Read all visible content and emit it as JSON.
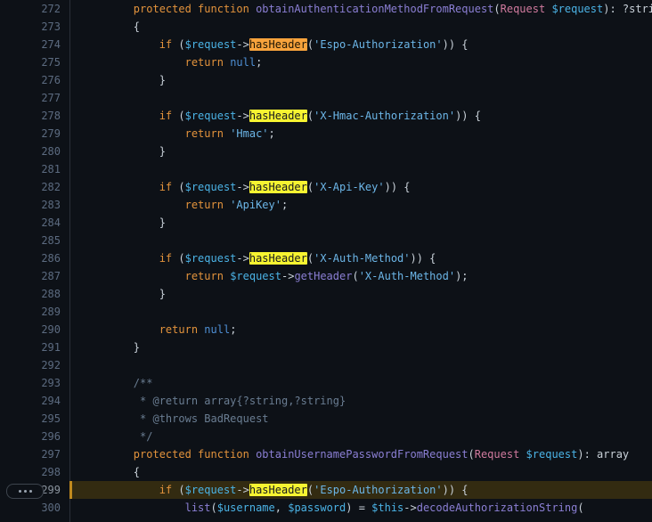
{
  "editor": {
    "background": "#0d1117",
    "line_height_px": 20,
    "font_size_px": 12,
    "gutter_rule_color": "#2a3038",
    "active_line_background": "#332b11",
    "active_line_marker_color": "#c08a1e",
    "search_current_match_color": "#f8a33c",
    "search_match_color": "#f7f431",
    "search_term": "hasHeader",
    "gutter": {
      "more_actions_label": "•••",
      "more_actions_line": "299"
    }
  },
  "lines": [
    {
      "no": "272",
      "active": false,
      "tokens": [
        {
          "text": "        ",
          "cls": "t-plain"
        },
        {
          "text": "protected function ",
          "cls": "t-kw"
        },
        {
          "text": "obtainAuthenticationMethodFromRequest",
          "cls": "t-fn"
        },
        {
          "text": "(",
          "cls": "t-punc"
        },
        {
          "text": "Request",
          "cls": "t-type"
        },
        {
          "text": " ",
          "cls": "t-plain"
        },
        {
          "text": "$request",
          "cls": "t-var"
        },
        {
          "text": "): ?string",
          "cls": "t-plain"
        }
      ]
    },
    {
      "no": "273",
      "active": false,
      "tokens": [
        {
          "text": "        {",
          "cls": "t-punc"
        }
      ]
    },
    {
      "no": "274",
      "active": false,
      "tokens": [
        {
          "text": "            ",
          "cls": "t-plain"
        },
        {
          "text": "if",
          "cls": "t-kw"
        },
        {
          "text": " (",
          "cls": "t-punc"
        },
        {
          "text": "$request",
          "cls": "t-var"
        },
        {
          "text": "->",
          "cls": "t-punc"
        },
        {
          "text": "hasHeader",
          "cls": "hl-current"
        },
        {
          "text": "(",
          "cls": "t-punc"
        },
        {
          "text": "'Espo-Authorization'",
          "cls": "t-str"
        },
        {
          "text": ")) {",
          "cls": "t-punc"
        }
      ]
    },
    {
      "no": "275",
      "active": false,
      "tokens": [
        {
          "text": "                ",
          "cls": "t-plain"
        },
        {
          "text": "return",
          "cls": "t-kw"
        },
        {
          "text": " ",
          "cls": "t-plain"
        },
        {
          "text": "null",
          "cls": "t-const"
        },
        {
          "text": ";",
          "cls": "t-punc"
        }
      ]
    },
    {
      "no": "276",
      "active": false,
      "tokens": [
        {
          "text": "            }",
          "cls": "t-punc"
        }
      ]
    },
    {
      "no": "277",
      "active": false,
      "tokens": []
    },
    {
      "no": "278",
      "active": false,
      "tokens": [
        {
          "text": "            ",
          "cls": "t-plain"
        },
        {
          "text": "if",
          "cls": "t-kw"
        },
        {
          "text": " (",
          "cls": "t-punc"
        },
        {
          "text": "$request",
          "cls": "t-var"
        },
        {
          "text": "->",
          "cls": "t-punc"
        },
        {
          "text": "hasHeader",
          "cls": "hl-match"
        },
        {
          "text": "(",
          "cls": "t-punc"
        },
        {
          "text": "'X-Hmac-Authorization'",
          "cls": "t-str"
        },
        {
          "text": ")) {",
          "cls": "t-punc"
        }
      ]
    },
    {
      "no": "279",
      "active": false,
      "tokens": [
        {
          "text": "                ",
          "cls": "t-plain"
        },
        {
          "text": "return",
          "cls": "t-kw"
        },
        {
          "text": " ",
          "cls": "t-plain"
        },
        {
          "text": "'Hmac'",
          "cls": "t-str"
        },
        {
          "text": ";",
          "cls": "t-punc"
        }
      ]
    },
    {
      "no": "280",
      "active": false,
      "tokens": [
        {
          "text": "            }",
          "cls": "t-punc"
        }
      ]
    },
    {
      "no": "281",
      "active": false,
      "tokens": []
    },
    {
      "no": "282",
      "active": false,
      "tokens": [
        {
          "text": "            ",
          "cls": "t-plain"
        },
        {
          "text": "if",
          "cls": "t-kw"
        },
        {
          "text": " (",
          "cls": "t-punc"
        },
        {
          "text": "$request",
          "cls": "t-var"
        },
        {
          "text": "->",
          "cls": "t-punc"
        },
        {
          "text": "hasHeader",
          "cls": "hl-match"
        },
        {
          "text": "(",
          "cls": "t-punc"
        },
        {
          "text": "'X-Api-Key'",
          "cls": "t-str"
        },
        {
          "text": ")) {",
          "cls": "t-punc"
        }
      ]
    },
    {
      "no": "283",
      "active": false,
      "tokens": [
        {
          "text": "                ",
          "cls": "t-plain"
        },
        {
          "text": "return",
          "cls": "t-kw"
        },
        {
          "text": " ",
          "cls": "t-plain"
        },
        {
          "text": "'ApiKey'",
          "cls": "t-str"
        },
        {
          "text": ";",
          "cls": "t-punc"
        }
      ]
    },
    {
      "no": "284",
      "active": false,
      "tokens": [
        {
          "text": "            }",
          "cls": "t-punc"
        }
      ]
    },
    {
      "no": "285",
      "active": false,
      "tokens": []
    },
    {
      "no": "286",
      "active": false,
      "tokens": [
        {
          "text": "            ",
          "cls": "t-plain"
        },
        {
          "text": "if",
          "cls": "t-kw"
        },
        {
          "text": " (",
          "cls": "t-punc"
        },
        {
          "text": "$request",
          "cls": "t-var"
        },
        {
          "text": "->",
          "cls": "t-punc"
        },
        {
          "text": "hasHeader",
          "cls": "hl-match"
        },
        {
          "text": "(",
          "cls": "t-punc"
        },
        {
          "text": "'X-Auth-Method'",
          "cls": "t-str"
        },
        {
          "text": ")) {",
          "cls": "t-punc"
        }
      ]
    },
    {
      "no": "287",
      "active": false,
      "tokens": [
        {
          "text": "                ",
          "cls": "t-plain"
        },
        {
          "text": "return",
          "cls": "t-kw"
        },
        {
          "text": " ",
          "cls": "t-plain"
        },
        {
          "text": "$request",
          "cls": "t-var"
        },
        {
          "text": "->",
          "cls": "t-punc"
        },
        {
          "text": "getHeader",
          "cls": "t-fn"
        },
        {
          "text": "(",
          "cls": "t-punc"
        },
        {
          "text": "'X-Auth-Method'",
          "cls": "t-str"
        },
        {
          "text": ");",
          "cls": "t-punc"
        }
      ]
    },
    {
      "no": "288",
      "active": false,
      "tokens": [
        {
          "text": "            }",
          "cls": "t-punc"
        }
      ]
    },
    {
      "no": "289",
      "active": false,
      "tokens": []
    },
    {
      "no": "290",
      "active": false,
      "tokens": [
        {
          "text": "            ",
          "cls": "t-plain"
        },
        {
          "text": "return",
          "cls": "t-kw"
        },
        {
          "text": " ",
          "cls": "t-plain"
        },
        {
          "text": "null",
          "cls": "t-const"
        },
        {
          "text": ";",
          "cls": "t-punc"
        }
      ]
    },
    {
      "no": "291",
      "active": false,
      "tokens": [
        {
          "text": "        }",
          "cls": "t-punc"
        }
      ]
    },
    {
      "no": "292",
      "active": false,
      "tokens": []
    },
    {
      "no": "293",
      "active": false,
      "tokens": [
        {
          "text": "        /**",
          "cls": "t-comment"
        }
      ]
    },
    {
      "no": "294",
      "active": false,
      "tokens": [
        {
          "text": "         * @return array{?string,?string}",
          "cls": "t-comment"
        }
      ]
    },
    {
      "no": "295",
      "active": false,
      "tokens": [
        {
          "text": "         * @throws BadRequest",
          "cls": "t-comment"
        }
      ]
    },
    {
      "no": "296",
      "active": false,
      "tokens": [
        {
          "text": "         */",
          "cls": "t-comment"
        }
      ]
    },
    {
      "no": "297",
      "active": false,
      "tokens": [
        {
          "text": "        ",
          "cls": "t-plain"
        },
        {
          "text": "protected function ",
          "cls": "t-kw"
        },
        {
          "text": "obtainUsernamePasswordFromRequest",
          "cls": "t-fn"
        },
        {
          "text": "(",
          "cls": "t-punc"
        },
        {
          "text": "Request",
          "cls": "t-type"
        },
        {
          "text": " ",
          "cls": "t-plain"
        },
        {
          "text": "$request",
          "cls": "t-var"
        },
        {
          "text": "): array",
          "cls": "t-plain"
        }
      ]
    },
    {
      "no": "298",
      "active": false,
      "tokens": [
        {
          "text": "        {",
          "cls": "t-punc"
        }
      ]
    },
    {
      "no": "299",
      "active": true,
      "tokens": [
        {
          "text": "            ",
          "cls": "t-plain"
        },
        {
          "text": "if",
          "cls": "t-kw"
        },
        {
          "text": " (",
          "cls": "t-punc"
        },
        {
          "text": "$request",
          "cls": "t-var"
        },
        {
          "text": "->",
          "cls": "t-punc"
        },
        {
          "text": "hasHeader",
          "cls": "hl-match"
        },
        {
          "text": "(",
          "cls": "t-punc"
        },
        {
          "text": "'Espo-Authorization'",
          "cls": "t-str"
        },
        {
          "text": ")) {",
          "cls": "t-punc"
        }
      ]
    },
    {
      "no": "300",
      "active": false,
      "tokens": [
        {
          "text": "                ",
          "cls": "t-plain"
        },
        {
          "text": "list",
          "cls": "t-fn"
        },
        {
          "text": "(",
          "cls": "t-punc"
        },
        {
          "text": "$username",
          "cls": "t-var"
        },
        {
          "text": ", ",
          "cls": "t-punc"
        },
        {
          "text": "$password",
          "cls": "t-var"
        },
        {
          "text": ") = ",
          "cls": "t-punc"
        },
        {
          "text": "$this",
          "cls": "t-var"
        },
        {
          "text": "->",
          "cls": "t-punc"
        },
        {
          "text": "decodeAuthorizationString",
          "cls": "t-fn"
        },
        {
          "text": "(",
          "cls": "t-punc"
        }
      ]
    }
  ]
}
